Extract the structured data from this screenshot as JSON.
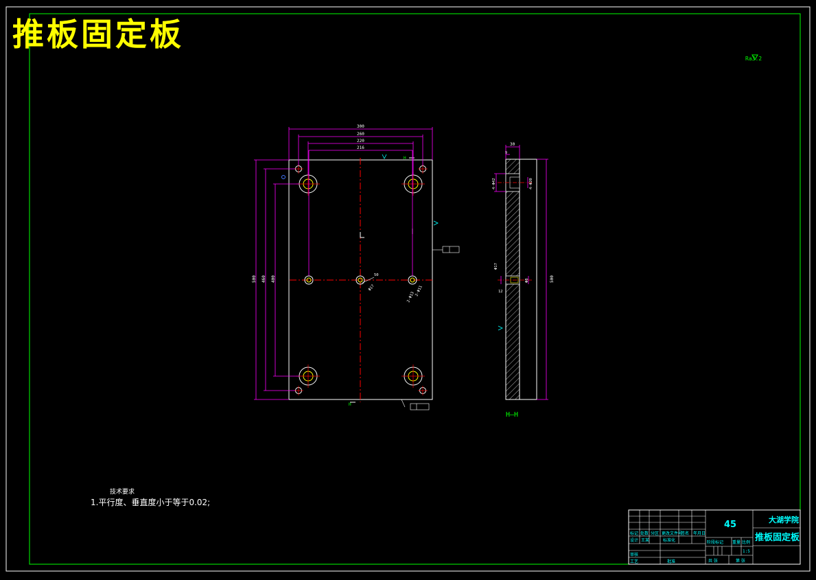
{
  "drawing": {
    "title": "推板固定板",
    "surface_finish": "Ra3.2",
    "section_label": "H—H"
  },
  "dims": {
    "w300": "300",
    "w260": "260",
    "w220": "220",
    "w216": "216",
    "h500": "500",
    "h460": "460",
    "h400": "400",
    "hole_a": "2-Φ13",
    "hole_b": "2-Φ11",
    "center_hole": "Φ17",
    "center_depth": "50",
    "thick30": "30",
    "step9": "9",
    "cb_a": "4-Φ42",
    "cb_b": "4-Φ20",
    "side_h": "500",
    "sec_d17": "Φ17",
    "sec_d12": "12",
    "sec_d8": "Φ8"
  },
  "technical_requirements": {
    "heading": "技术要求",
    "line1": "1.平行度、垂直度小于等于0.02;"
  },
  "title_block": {
    "material": "45",
    "school": "大湖学院",
    "part_name": "推板固定板",
    "scale": "1:5",
    "labels": {
      "mark": "标记",
      "count": "处数",
      "zone": "分区",
      "change_doc": "更改文件号",
      "signature": "签名",
      "date": "年月日",
      "design": "设计",
      "designer": "王某",
      "standard": "标准化",
      "review": "审核",
      "process": "工艺",
      "approve": "批准",
      "stage": "阶段标记",
      "weight": "重量",
      "ratio": "比例",
      "total": "共 张",
      "sheet": "第 张"
    }
  },
  "colors": {
    "frame": "#00ff00",
    "outline": "#ffffff",
    "dimension": "#ff00ff",
    "centerline": "#ff0000",
    "hole": "#ffff00",
    "text": "#00ffff",
    "title": "#ffff00"
  }
}
